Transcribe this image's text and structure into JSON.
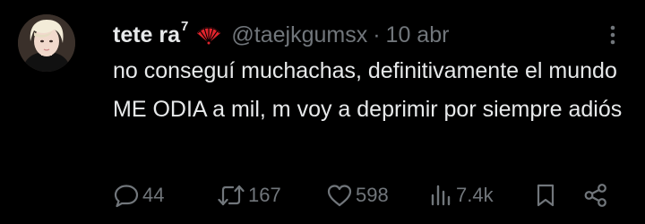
{
  "tweet": {
    "display_name": "tete ra",
    "name_superscript": "7",
    "badge_icon": "folding-fan-icon",
    "badge_color": "#e0242c",
    "handle": "@taejkgumsx",
    "separator": "·",
    "date": "10 abr",
    "text": "no conseguí muchachas, definitivamente el mundo ME ODIA a mil, m voy a deprimir por siempre adiós"
  },
  "actions": {
    "replies": "44",
    "reposts": "167",
    "likes": "598",
    "views": "7.4k"
  },
  "colors": {
    "background": "#000000",
    "text": "#e7e9ea",
    "muted": "#71767b"
  }
}
